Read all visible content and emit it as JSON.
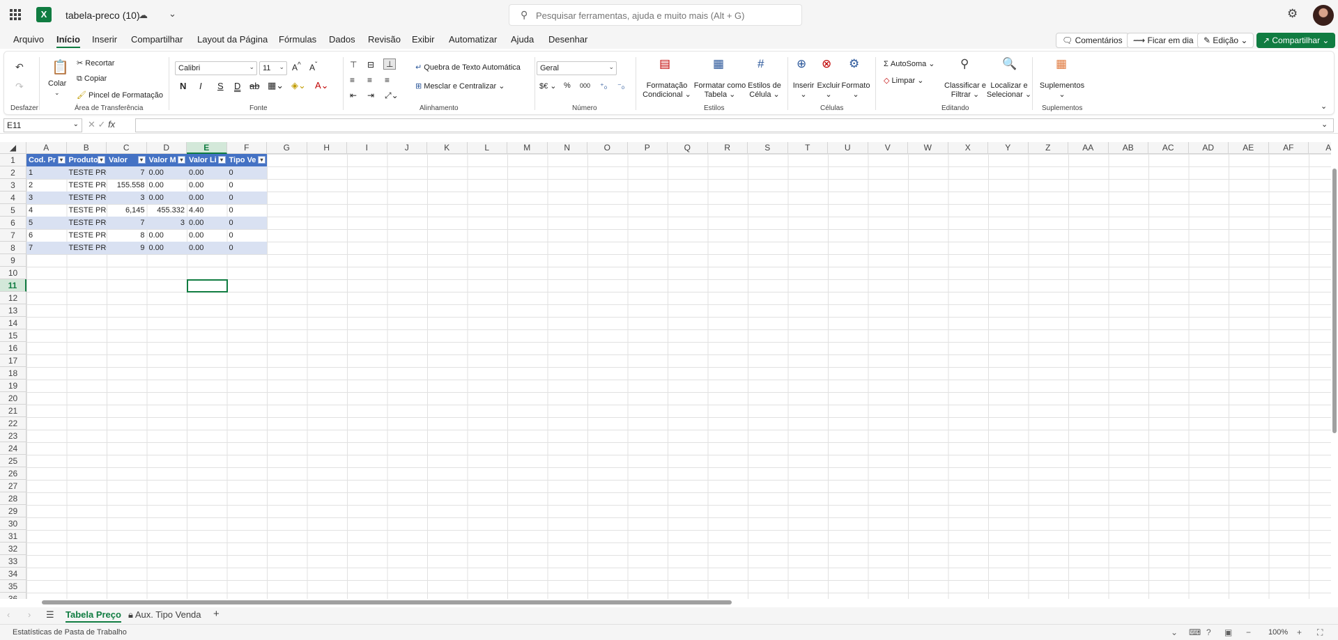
{
  "app": {
    "doc_title": "tabela-preco (10)",
    "logo_letter": "X",
    "search_placeholder": "Pesquisar ferramentas, ajuda e muito mais (Alt + G)"
  },
  "menu": {
    "tabs": [
      "Arquivo",
      "Início",
      "Inserir",
      "Compartilhar",
      "Layout da Página",
      "Fórmulas",
      "Dados",
      "Revisão",
      "Exibir",
      "Automatizar",
      "Ajuda",
      "Desenhar"
    ],
    "active_tab": "Início",
    "comments_label": "Comentários",
    "catchup_label": "Ficar em dia",
    "editing_label": "Edição",
    "share_label": "Compartilhar"
  },
  "ribbon": {
    "undo_group": "Desfazer",
    "clipboard": {
      "paste": "Colar",
      "cut": "Recortar",
      "copy": "Copiar",
      "format_painter": "Pincel de Formatação",
      "group": "Área de Transferência"
    },
    "font": {
      "name": "Calibri",
      "size": "11",
      "bold": "N",
      "italic": "I",
      "underline": "S",
      "dunder": "D",
      "group": "Fonte"
    },
    "alignment": {
      "wrap": "Quebra de Texto Automática",
      "merge": "Mesclar e Centralizar",
      "group": "Alinhamento"
    },
    "number": {
      "format": "Geral",
      "currency": "$€",
      "percent": "%",
      "thousands": "000",
      "group": "Número"
    },
    "styles": {
      "cond_format_1": "Formatação",
      "cond_format_2": "Condicional",
      "format_table_1": "Formatar como",
      "format_table_2": "Tabela",
      "cell_styles_1": "Estilos de",
      "cell_styles_2": "Célula",
      "group": "Estilos"
    },
    "cells": {
      "insert": "Inserir",
      "delete": "Excluir",
      "format": "Formato",
      "group": "Células"
    },
    "editing": {
      "autosum": "AutoSoma",
      "clear": "Limpar",
      "sort_1": "Classificar e",
      "sort_2": "Filtrar",
      "find_1": "Localizar e",
      "find_2": "Selecionar",
      "group": "Editando"
    },
    "addins": {
      "label": "Suplementos",
      "group": "Suplementos"
    }
  },
  "formula_bar": {
    "name_box": "E11",
    "fx": "fx",
    "formula": ""
  },
  "grid": {
    "columns": [
      "A",
      "B",
      "C",
      "D",
      "E",
      "F",
      "G",
      "H",
      "I",
      "J",
      "K",
      "L",
      "M",
      "N",
      "O",
      "P",
      "Q",
      "R",
      "S",
      "T",
      "U",
      "V",
      "W",
      "X",
      "Y",
      "Z",
      "AA",
      "AB",
      "AC",
      "AD",
      "AE",
      "AF",
      "A"
    ],
    "selected_column": "E",
    "rows": [
      "1",
      "2",
      "3",
      "4",
      "5",
      "6",
      "7",
      "8",
      "9",
      "10",
      "11",
      "12",
      "13",
      "14",
      "15",
      "16",
      "17",
      "18",
      "19",
      "20",
      "21",
      "22",
      "23",
      "24",
      "25",
      "26",
      "27",
      "28",
      "29",
      "30",
      "31",
      "32",
      "33",
      "34",
      "35",
      "36"
    ],
    "selected_row": "11",
    "table_headers": [
      "Cod. Pr",
      "Produto",
      "Valor",
      "Valor M",
      "Valor Li",
      "Tipo Ve"
    ],
    "table_rows": [
      [
        "1",
        "TESTE PRO",
        "7",
        "0.00",
        "0.00",
        "0"
      ],
      [
        "2",
        "TESTE PRO",
        "155.558",
        "0.00",
        "0.00",
        "0"
      ],
      [
        "3",
        "TESTE PRO",
        "3",
        "0.00",
        "0.00",
        "0"
      ],
      [
        "4",
        "TESTE PRO",
        "6,145",
        "455.332",
        "4.40",
        "0"
      ],
      [
        "5",
        "TESTE PRO",
        "7",
        "3",
        "0.00",
        "0"
      ],
      [
        "6",
        "TESTE PRO",
        "8",
        "0.00",
        "0.00",
        "0"
      ],
      [
        "7",
        "TESTE PRO",
        "9",
        "0.00",
        "0.00",
        "0"
      ]
    ]
  },
  "sheets": {
    "tabs": [
      "Tabela Preço",
      "Aux. Tipo Venda"
    ],
    "active": "Tabela Preço"
  },
  "status": {
    "text": "Estatísticas de Pasta de Trabalho",
    "zoom": "100%"
  },
  "colors": {
    "accent": "#107c41",
    "table_header": "#4472c4",
    "table_band": "#d9e1f2"
  }
}
